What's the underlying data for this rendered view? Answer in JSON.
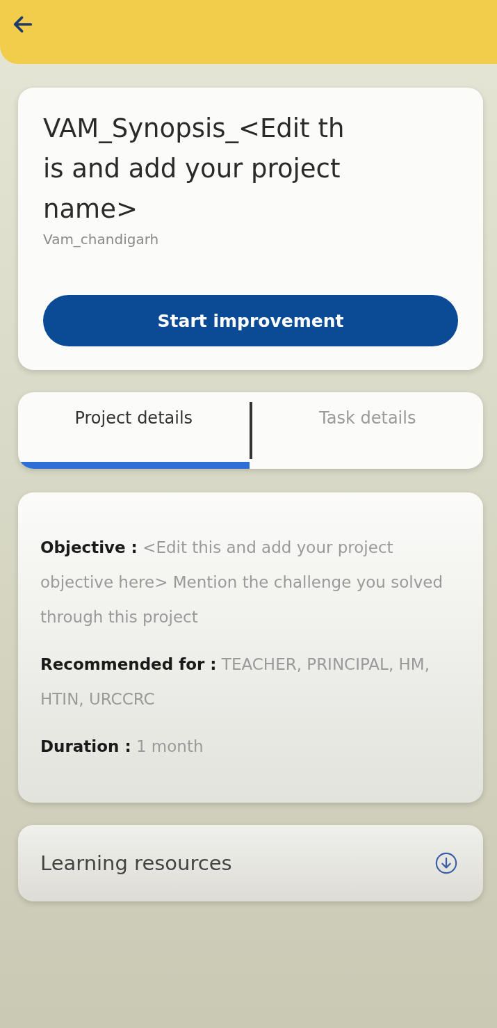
{
  "header": {
    "back": true
  },
  "project": {
    "title": "VAM_Synopsis_<Edit this and add your project name>",
    "subtitle": "Vam_chandigarh",
    "button": "Start improvement"
  },
  "tabs": [
    {
      "label": "Project details",
      "selected": true
    },
    {
      "label": "Task details",
      "selected": false
    }
  ],
  "details": [
    {
      "label": "Objective :",
      "value": "<Edit this and add your project objective here> Mention the challenge you solved through this project"
    },
    {
      "label": "Recommended for :",
      "value": "TEACHER, PRINCIPAL, HM, HTIN, URCCRC"
    },
    {
      "label": "Duration :",
      "value": "1 month"
    }
  ],
  "learning_resources": {
    "label": "Learning resources",
    "expanded": false
  }
}
